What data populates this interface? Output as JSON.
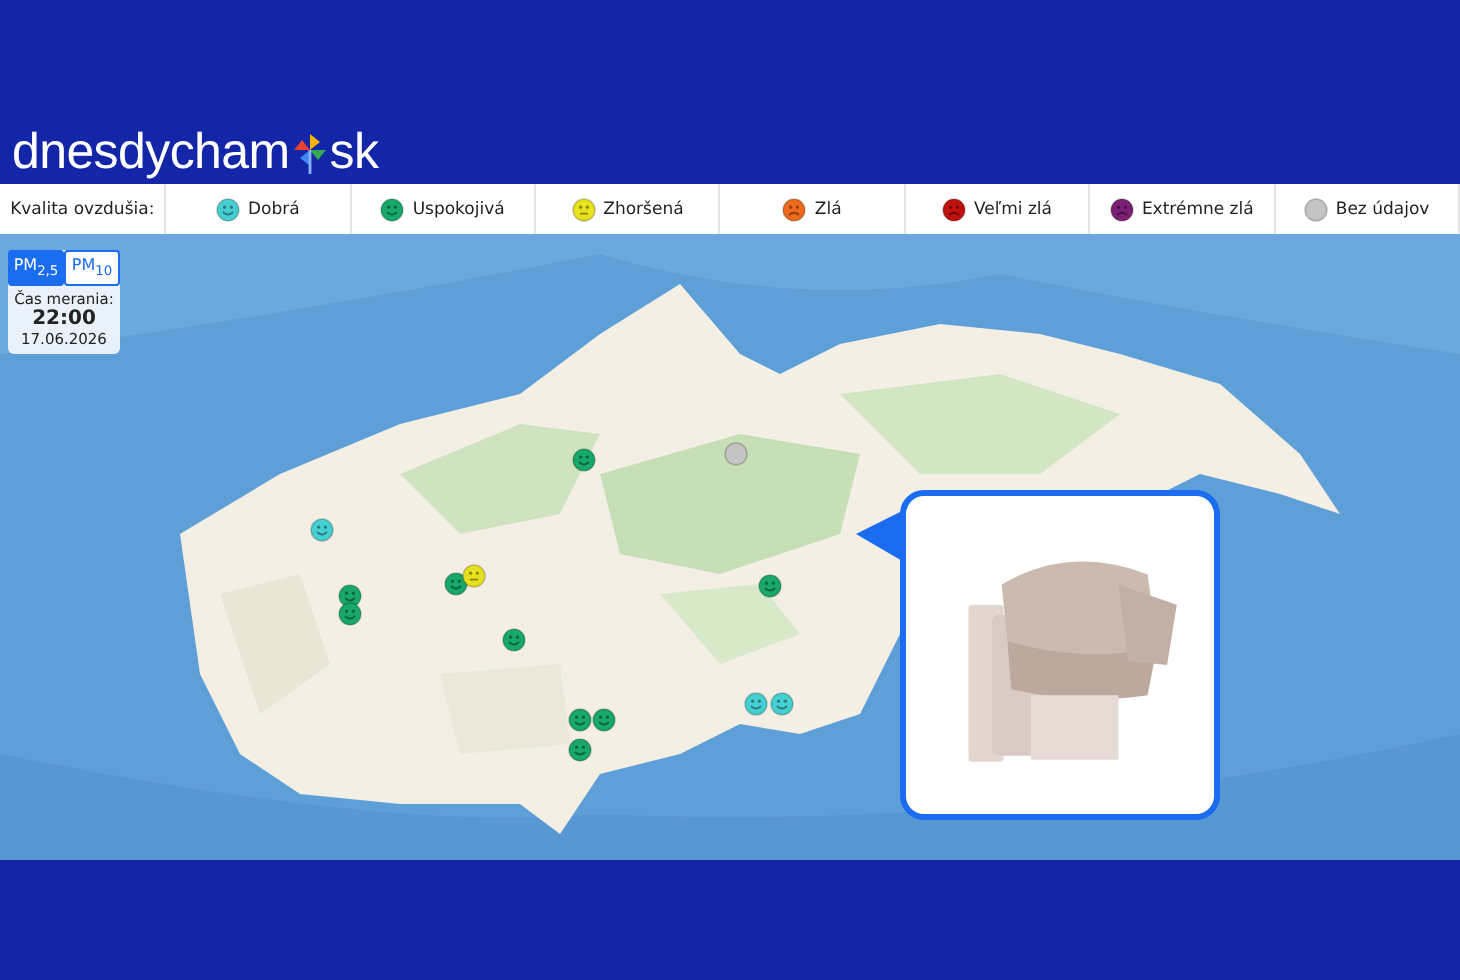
{
  "logo": {
    "name": "dnesdycham",
    "suffix": "sk"
  },
  "legend": {
    "label": "Kvalita ovzdušia:",
    "items": [
      {
        "label": "Dobrá",
        "color": "#45cfd0",
        "kind": "smile"
      },
      {
        "label": "Uspokojivá",
        "color": "#17a86a",
        "kind": "smile"
      },
      {
        "label": "Zhoršená",
        "color": "#e6e01e",
        "kind": "flat"
      },
      {
        "label": "Zlá",
        "color": "#ee6a1c",
        "kind": "frown"
      },
      {
        "label": "Veľmi zlá",
        "color": "#c0120f",
        "kind": "frown"
      },
      {
        "label": "Extrémne zlá",
        "color": "#7a1f74",
        "kind": "frown"
      },
      {
        "label": "Bez údajov",
        "color": "#c4c4c4",
        "kind": "blank"
      }
    ]
  },
  "pollutant_tabs": [
    {
      "label": "PM$_{2,5}$",
      "selected": true
    },
    {
      "label": "PM$_{10}$",
      "selected": false
    }
  ],
  "measurement": {
    "label": "Čas merania:",
    "time": "22:00",
    "date": "17.06.2026"
  },
  "markers": [
    {
      "color": "#45cfd0",
      "kind": "smile"
    },
    {
      "color": "#17a86a",
      "kind": "smile"
    },
    {
      "color": "#17a86a",
      "kind": "smile"
    },
    {
      "color": "#17a86a",
      "kind": "smile"
    },
    {
      "color": "#e6e01e",
      "kind": "flat"
    },
    {
      "color": "#17a86a",
      "kind": "smile"
    },
    {
      "color": "#17a86a",
      "kind": "smile"
    },
    {
      "color": "#17a86a",
      "kind": "smile"
    },
    {
      "color": "#17a86a",
      "kind": "smile"
    },
    {
      "color": "#17a86a",
      "kind": "smile"
    },
    {
      "color": "#17a86a",
      "kind": "smile"
    },
    {
      "color": "#45cfd0",
      "kind": "smile"
    },
    {
      "color": "#45cfd0",
      "kind": "smile"
    },
    {
      "color": "#c4c4c4",
      "kind": "blank"
    }
  ]
}
